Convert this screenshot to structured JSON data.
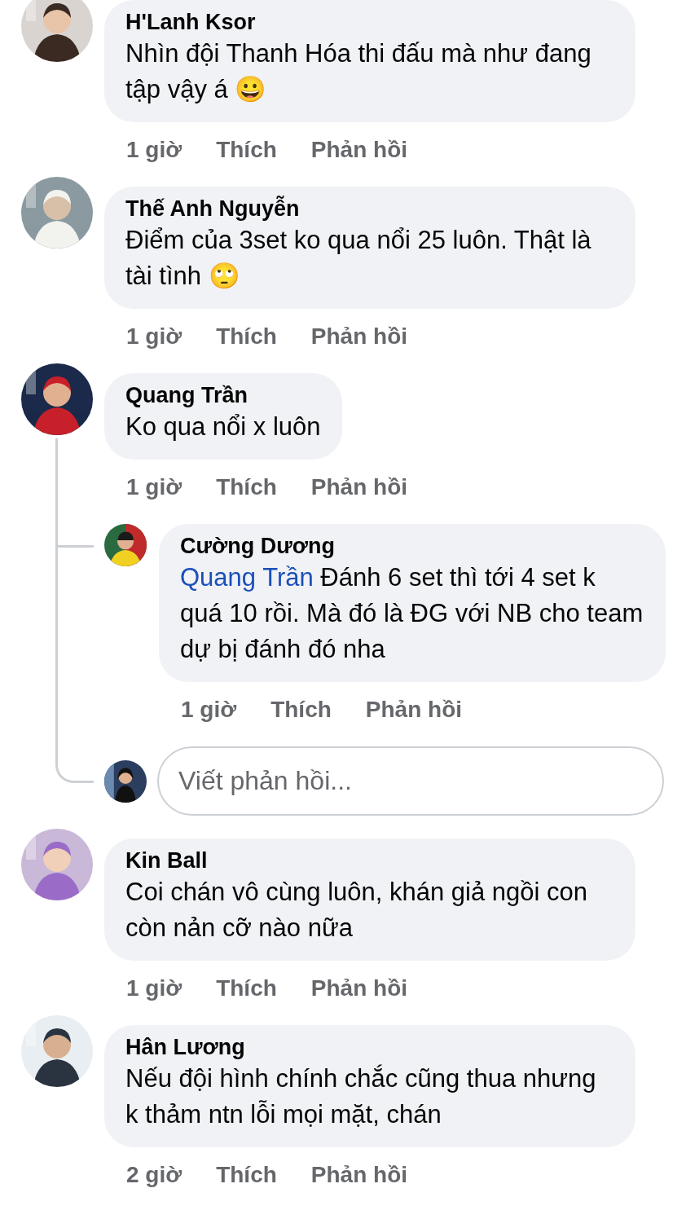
{
  "comments": [
    {
      "author": "H'Lanh Ksor",
      "text": "Nhìn đội Thanh Hóa thi đấu mà như đang tập vậy á 😀",
      "time": "1 giờ",
      "like": "Thích",
      "reply": "Phản hồi"
    },
    {
      "author": "Thế Anh Nguyễn",
      "text": "Điểm của 3set ko qua nổi 25 luôn. Thật là tài tình 🙄",
      "time": "1 giờ",
      "like": "Thích",
      "reply": "Phản hồi"
    },
    {
      "author": "Quang Trần",
      "text": "Ko qua nổi x luôn",
      "time": "1 giờ",
      "like": "Thích",
      "reply": "Phản hồi",
      "replies": [
        {
          "author": "Cường Dương",
          "mention": "Quang Trần",
          "text": "Đánh 6 set thì tới 4 set k quá 10 rồi. Mà đó là ĐG với NB cho team dự bị đánh đó nha",
          "time": "1 giờ",
          "like": "Thích",
          "reply": "Phản hồi"
        }
      ],
      "reply_box": {
        "placeholder": "Viết phản hồi..."
      }
    },
    {
      "author": "Kin Ball",
      "text": "Coi chán vô cùng luôn, khán giả ngồi con còn nản cỡ nào nữa",
      "time": "1 giờ",
      "like": "Thích",
      "reply": "Phản hồi"
    },
    {
      "author": "Hân Lương",
      "text": "Nếu đội hình chính chắc cũng thua nhưng k thảm ntn lỗi mọi mặt, chán",
      "time": "2 giờ",
      "like": "Thích",
      "reply": "Phản hồi"
    }
  ]
}
